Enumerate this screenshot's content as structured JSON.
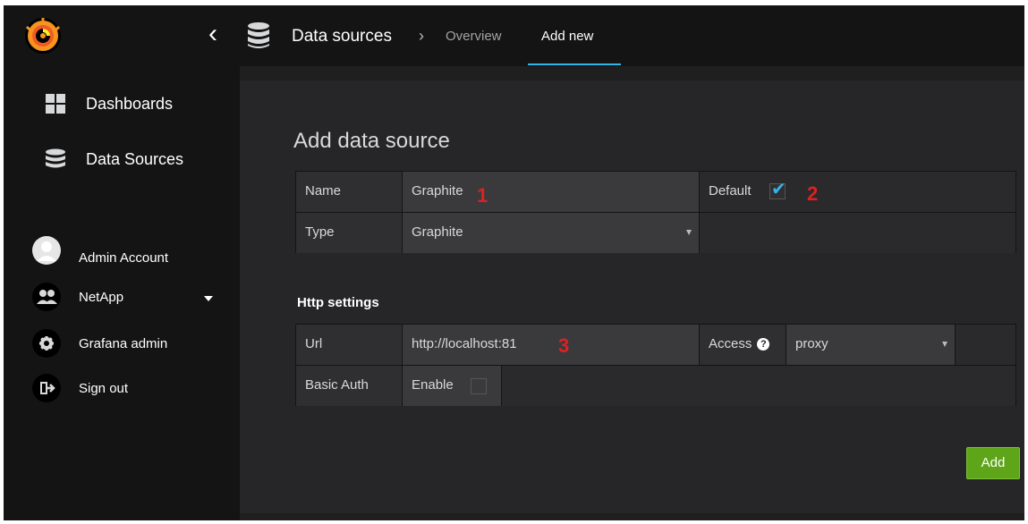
{
  "nav": {
    "back_glyph": "‹",
    "section_title": "Data sources",
    "separator": "›",
    "tabs": [
      {
        "label": "Overview",
        "active": false
      },
      {
        "label": "Add new",
        "active": true
      }
    ],
    "accent": "#33b5e5"
  },
  "sidebar": {
    "items": [
      {
        "label": "Dashboards",
        "icon": "dashboards-grid-icon"
      },
      {
        "label": "Data Sources",
        "icon": "database-icon"
      }
    ],
    "user_items": [
      {
        "label": "Admin Account",
        "icon": "avatar-icon"
      },
      {
        "label": "NetApp",
        "icon": "users-icon",
        "has_dropdown": true
      },
      {
        "label": "Grafana admin",
        "icon": "gear-icon"
      },
      {
        "label": "Sign out",
        "icon": "sign-out-icon"
      }
    ]
  },
  "main": {
    "title": "Add data source",
    "form": {
      "name_label": "Name",
      "name_value": "Graphite",
      "default_label": "Default",
      "default_checked": true,
      "type_label": "Type",
      "type_value": "Graphite"
    },
    "http": {
      "section_title": "Http settings",
      "url_label": "Url",
      "url_value": "http://localhost:81",
      "access_label": "Access",
      "access_help": "?",
      "access_value": "proxy",
      "basic_auth_label": "Basic Auth",
      "enable_label": "Enable",
      "enable_checked": false
    },
    "annotations": [
      "1",
      "2",
      "3"
    ],
    "add_button": "Add",
    "add_button_color": "#5ea519"
  }
}
